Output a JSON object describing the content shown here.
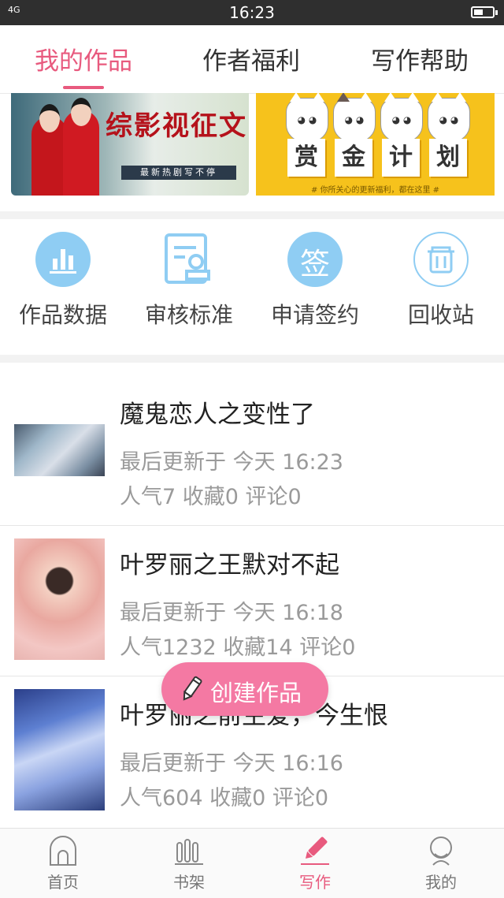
{
  "status_bar": {
    "signal": "4G",
    "time": "16:23"
  },
  "tabs": [
    {
      "label": "我的作品",
      "active": true
    },
    {
      "label": "作者福利",
      "active": false
    },
    {
      "label": "写作帮助",
      "active": false
    }
  ],
  "banners": {
    "left": {
      "title": "综影视征文",
      "subtitle": "最新热剧写不停"
    },
    "right": {
      "chars": [
        "赏",
        "金",
        "计",
        "划"
      ],
      "tagline": "# 你所关心的更新福利，都在这里 #"
    }
  },
  "actions": [
    {
      "label": "作品数据",
      "icon": "bar-chart-icon"
    },
    {
      "label": "审核标准",
      "icon": "review-doc-icon"
    },
    {
      "label": "申请签约",
      "icon": "sign-icon",
      "icon_text": "签"
    },
    {
      "label": "回收站",
      "icon": "trash-icon"
    }
  ],
  "works": [
    {
      "title": "魔鬼恋人之变性了",
      "updated": "最后更新于 今天 16:23",
      "stats": "人气7 收藏0 评论0"
    },
    {
      "title": "叶罗丽之王默对不起",
      "updated": "最后更新于 今天 16:18",
      "stats": "人气1232 收藏14 评论0"
    },
    {
      "title": "叶罗丽之前生爱，今生恨",
      "updated": "最后更新于 今天 16:16",
      "stats": "人气604 收藏0 评论0"
    }
  ],
  "create_button": {
    "label": "创建作品"
  },
  "bottom_nav": [
    {
      "label": "首页",
      "active": false
    },
    {
      "label": "书架",
      "active": false
    },
    {
      "label": "写作",
      "active": true
    },
    {
      "label": "我的",
      "active": false
    }
  ],
  "colors": {
    "accent": "#e85a7e",
    "icon_blue": "#8fcdf3",
    "fab": "#f479a3"
  }
}
